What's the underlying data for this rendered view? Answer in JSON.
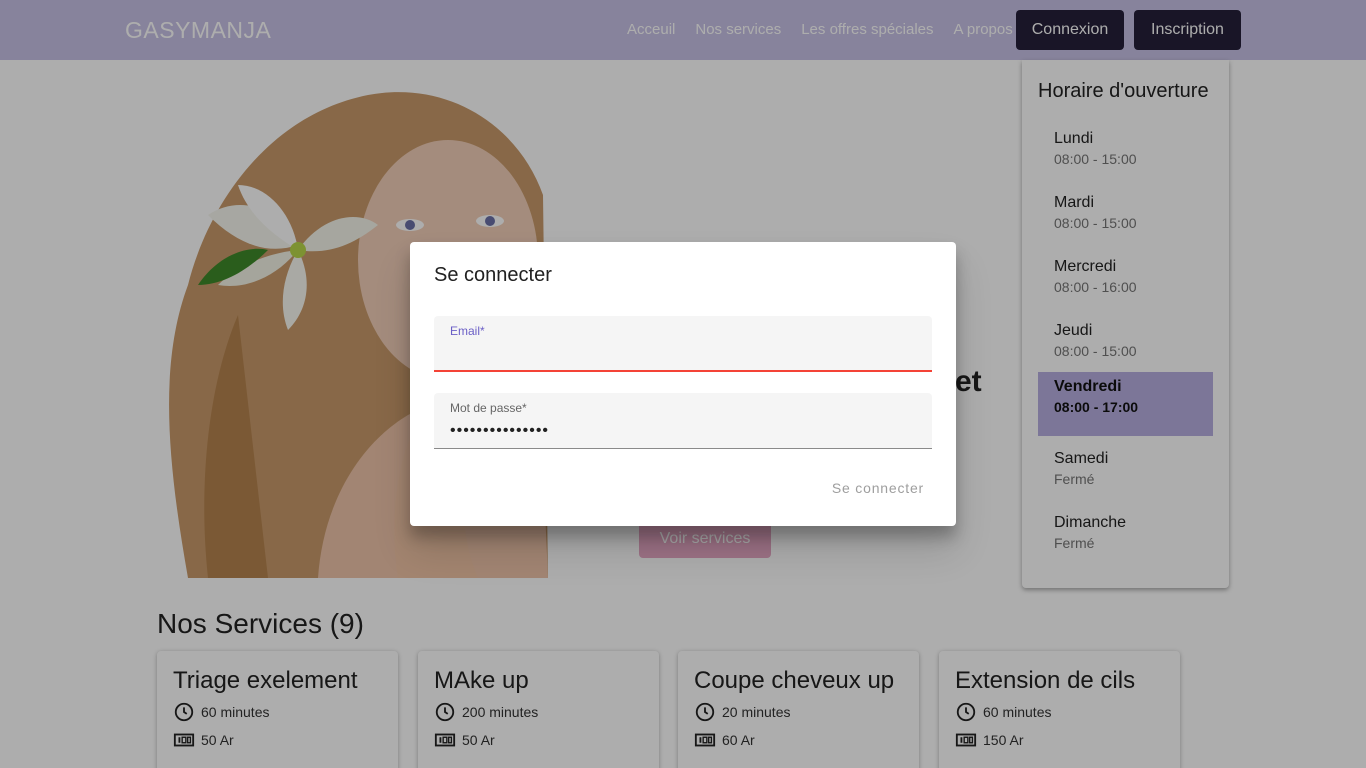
{
  "navbar": {
    "brand": "GASYMANJA",
    "links": [
      "Acceuil",
      "Nos services",
      "Les offres spéciales",
      "A propos"
    ],
    "login_label": "Connexion",
    "signup_label": "Inscription"
  },
  "hero": {
    "text_fragment": "et",
    "view_services_label": "Voir services"
  },
  "schedule": {
    "title": "Horaire d'ouverture",
    "days": [
      {
        "name": "Lundi",
        "hours": "08:00 - 15:00"
      },
      {
        "name": "Mardi",
        "hours": "08:00 - 15:00"
      },
      {
        "name": "Mercredi",
        "hours": "08:00 - 16:00"
      },
      {
        "name": "Jeudi",
        "hours": "08:00 - 15:00"
      },
      {
        "name": "Vendredi",
        "hours": "08:00 - 17:00"
      },
      {
        "name": "Samedi",
        "hours": "Fermé"
      },
      {
        "name": "Dimanche",
        "hours": "Fermé"
      }
    ],
    "active_day": "Vendredi"
  },
  "services": {
    "title": "Nos Services (9)",
    "cards": [
      {
        "name": "Triage exelement",
        "duration": "60 minutes",
        "price": "50 Ar"
      },
      {
        "name": "MAke up",
        "duration": "200 minutes",
        "price": "50 Ar"
      },
      {
        "name": "Coupe cheveux up",
        "duration": "20 minutes",
        "price": "60 Ar"
      },
      {
        "name": "Extension de cils",
        "duration": "60 minutes",
        "price": "150 Ar"
      }
    ]
  },
  "login_dialog": {
    "title": "Se connecter",
    "email_label": "Email*",
    "email_value": "",
    "password_label": "Mot de passe*",
    "password_value": "•••••••••••••••",
    "submit_label": "Se connecter"
  },
  "colors": {
    "navbar": "#c8c2e6",
    "nav_button": "#25203a",
    "active_day": "#b7afe0",
    "error_underline": "#f44336"
  }
}
